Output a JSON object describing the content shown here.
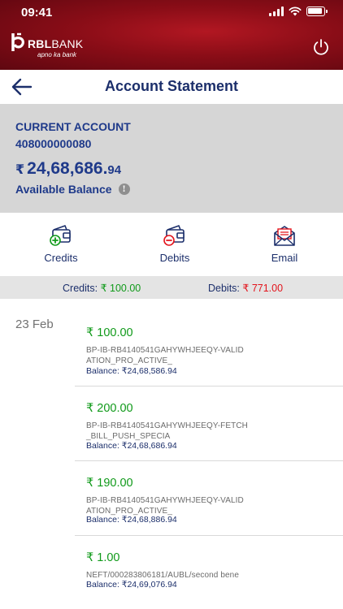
{
  "status_bar": {
    "time": "09:41"
  },
  "brand": {
    "name_bold": "RBL",
    "name_rest": "BANK",
    "tagline": "apno ka bank"
  },
  "header": {
    "title": "Account Statement"
  },
  "account": {
    "type": "CURRENT ACCOUNT",
    "number": "408000000080",
    "currency": "₹",
    "balance_main": "24,68,686.",
    "balance_decimal": "94",
    "balance_label": "Available Balance"
  },
  "actions": [
    {
      "label": "Credits",
      "icon": "wallet-plus-icon"
    },
    {
      "label": "Debits",
      "icon": "wallet-minus-icon"
    },
    {
      "label": "Email",
      "icon": "envelope-icon"
    }
  ],
  "summary": {
    "credits_label": "Credits:",
    "credits_value": "₹ 100.00",
    "debits_label": "Debits:",
    "debits_value": "₹ 771.00"
  },
  "statement": {
    "date": "23 Feb",
    "transactions": [
      {
        "amount": "₹ 100.00",
        "description_line1": "BP-IB-RB4140541GAHYWHJEEQY-VALID",
        "description_line2": "ATION_PRO_ACTIVE_",
        "balance": "Balance: ₹24,68,586.94"
      },
      {
        "amount": "₹ 200.00",
        "description_line1": "BP-IB-RB4140541GAHYWHJEEQY-FETCH",
        "description_line2": "_BILL_PUSH_SPECIA",
        "balance": "Balance: ₹24,68,686.94"
      },
      {
        "amount": "₹ 190.00",
        "description_line1": "BP-IB-RB4140541GAHYWHJEEQY-VALID",
        "description_line2": "ATION_PRO_ACTIVE_",
        "balance": "Balance: ₹24,68,886.94"
      },
      {
        "amount": "₹ 1.00",
        "description_line1": "NEFT/000283806181/AUBL/second bene",
        "description_line2": "",
        "balance": "Balance: ₹24,69,076.94"
      }
    ]
  },
  "colors": {
    "brand_red": "#8a0d17",
    "navy": "#1c2f6b",
    "credit_green": "#109a1a",
    "debit_red": "#e3141c"
  }
}
